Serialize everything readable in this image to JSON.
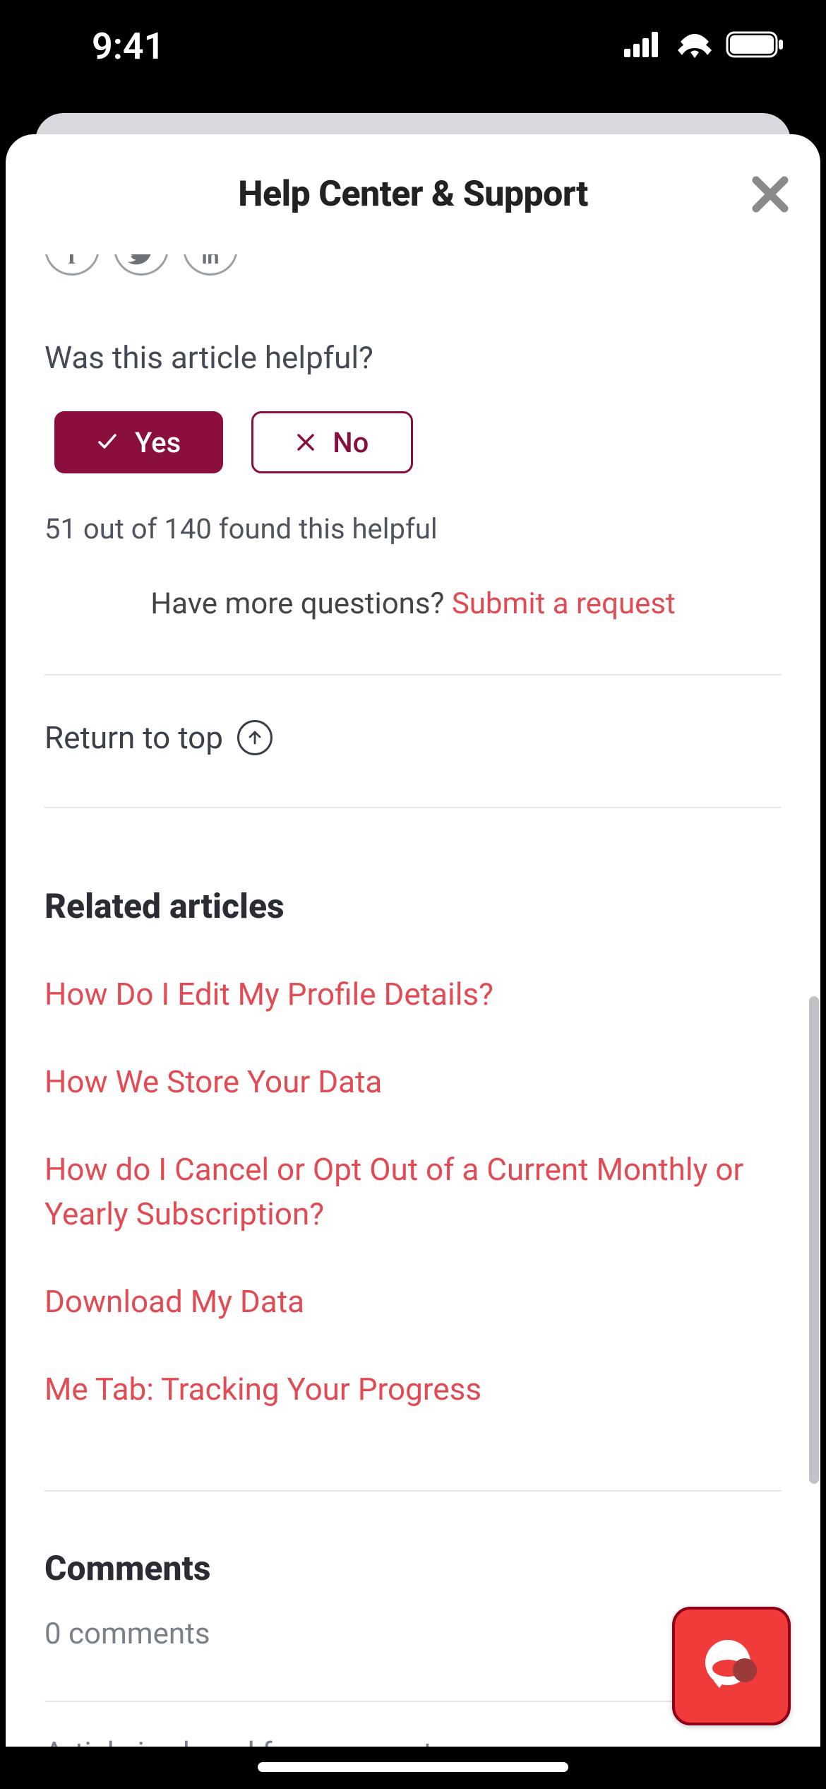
{
  "statusBar": {
    "time": "9:41"
  },
  "header": {
    "title": "Help Center & Support"
  },
  "feedback": {
    "question": "Was this article helpful?",
    "yesLabel": "Yes",
    "noLabel": "No",
    "stats": "51 out of 140 found this helpful",
    "moreQuestionsPrefix": "Have more questions? ",
    "submitLinkLabel": "Submit a request"
  },
  "returnTop": {
    "label": "Return to top"
  },
  "related": {
    "heading": "Related articles",
    "items": [
      "How Do I Edit My Profile Details?",
      "How We Store Your Data",
      "How do I Cancel or Opt Out of a Current Monthly or Yearly Subscription?",
      "Download My Data",
      "Me Tab: Tracking Your Progress"
    ]
  },
  "comments": {
    "heading": "Comments",
    "count": "0 comments",
    "closedMessage": "Article is closed for comments."
  }
}
